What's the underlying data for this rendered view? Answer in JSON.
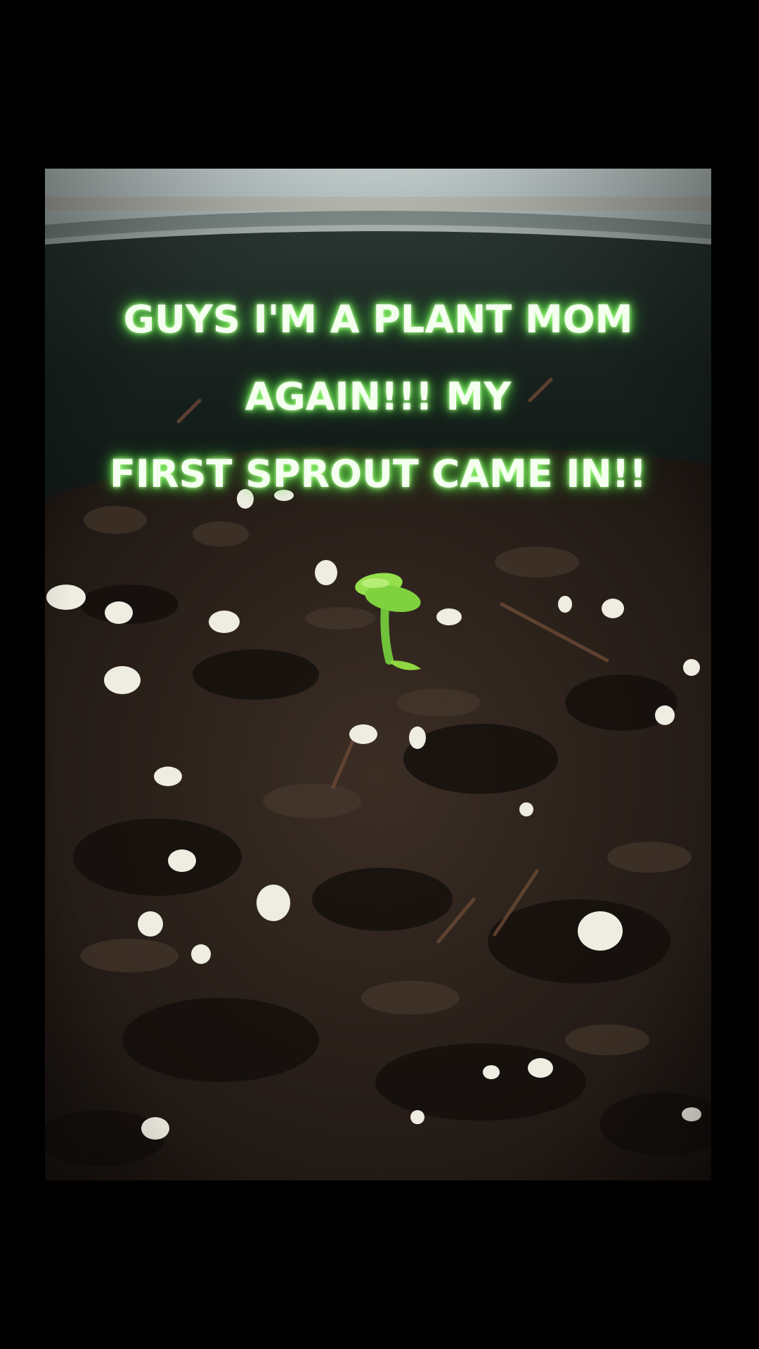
{
  "caption": "GUYS I'M A PLANT MOM AGAIN!!! MY\nFIRST SPROUT CAME IN!!",
  "colors": {
    "background": "#000000",
    "soil_dark": "#1a1512",
    "soil_mid": "#3a2c22",
    "pot": "#1c2522",
    "pot_rim_highlight": "#9aa8a3",
    "wall": "#c9d7d6",
    "sprout": "#8fe04a",
    "perlite": "#f2efe4",
    "caption_glow": "#7dff5a"
  },
  "scene": {
    "subject": "sprout-in-soil",
    "elements": [
      "wall",
      "pot-rim",
      "pot-inner-wall",
      "potting-soil",
      "perlite",
      "sprout"
    ]
  }
}
